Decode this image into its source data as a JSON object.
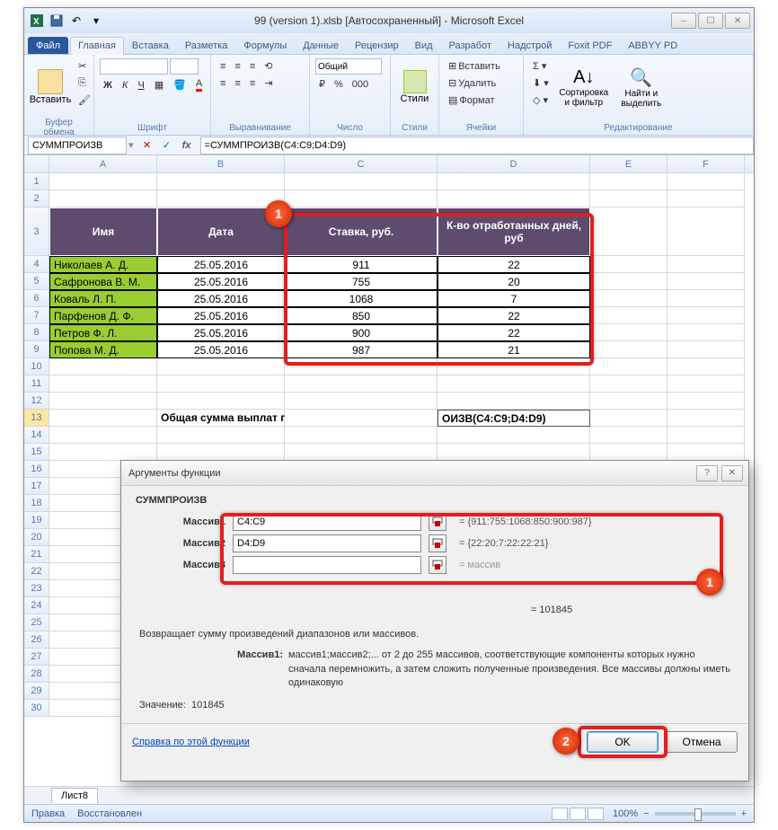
{
  "window": {
    "title": "99 (version 1).xlsb [Автосохраненный]  -  Microsoft Excel"
  },
  "tabs": {
    "file": "Файл",
    "home": "Главная",
    "insert": "Вставка",
    "layout": "Разметка",
    "formulas": "Формулы",
    "data": "Данные",
    "review": "Рецензир",
    "view": "Вид",
    "dev": "Разработ",
    "add": "Надстрой",
    "foxit": "Foxit PDF",
    "abbyy": "ABBYY PD"
  },
  "ribbon": {
    "clipboard": {
      "label": "Буфер обмена",
      "paste": "Вставить"
    },
    "font": {
      "label": "Шрифт"
    },
    "align": {
      "label": "Выравнивание"
    },
    "number": {
      "label": "Число",
      "format": "Общий"
    },
    "styles": {
      "label": "Стили",
      "btn": "Стили"
    },
    "cells": {
      "label": "Ячейки",
      "ins": "Вставить",
      "del": "Удалить",
      "fmt": "Формат"
    },
    "editing": {
      "label": "Редактирование",
      "sort": "Сортировка и фильтр",
      "find": "Найти и выделить"
    }
  },
  "formulabar": {
    "name": "СУММПРОИЗВ",
    "formula": "=СУММПРОИЗВ(C4:C9;D4:D9)"
  },
  "cols": [
    "A",
    "B",
    "C",
    "D",
    "E",
    "F"
  ],
  "headers": {
    "name": "Имя",
    "date": "Дата",
    "rate": "Ставка, руб.",
    "days": "К-во отработанных дней, руб"
  },
  "data_rows": [
    {
      "name": "Николаев А. Д.",
      "date": "25.05.2016",
      "rate": "911",
      "days": "22"
    },
    {
      "name": "Сафронова В. М.",
      "date": "25.05.2016",
      "rate": "755",
      "days": "20"
    },
    {
      "name": "Коваль Л. П.",
      "date": "25.05.2016",
      "rate": "1068",
      "days": "7"
    },
    {
      "name": "Парфенов Д. Ф.",
      "date": "25.05.2016",
      "rate": "850",
      "days": "22"
    },
    {
      "name": "Петров Ф. Л.",
      "date": "25.05.2016",
      "rate": "900",
      "days": "22"
    },
    {
      "name": "Попова М. Д.",
      "date": "25.05.2016",
      "rate": "987",
      "days": "21"
    }
  ],
  "row13": {
    "label": "Общая сумма выплат по предприятию",
    "value": "ОИЗВ(C4:C9;D4:D9)"
  },
  "dialog": {
    "title": "Аргументы функции",
    "fn": "СУММПРОИЗВ",
    "args": [
      {
        "label": "Массив1",
        "val": "C4:C9",
        "res": "= {911:755:1068:850:900:987}"
      },
      {
        "label": "Массив2",
        "val": "D4:D9",
        "res": "= {22:20:7:22:22:21}"
      },
      {
        "label": "Массив3",
        "val": "",
        "res": "= массив"
      }
    ],
    "eqresult": "= 101845",
    "desc": "Возвращает сумму произведений диапазонов или массивов.",
    "arglabel": "Массив1:",
    "argdesc": "массив1;массив2;... от 2 до 255 массивов, соответствующие компоненты которых нужно сначала перемножить, а затем сложить полученные произведения. Все массивы должны иметь одинаковую",
    "valuelabel": "Значение:",
    "value": "101845",
    "help": "Справка по этой функции",
    "ok": "OK",
    "cancel": "Отмена"
  },
  "sheet_tab": "Лист8",
  "status": {
    "mode": "Правка",
    "rec": "Восстановлен",
    "zoom": "100%"
  }
}
